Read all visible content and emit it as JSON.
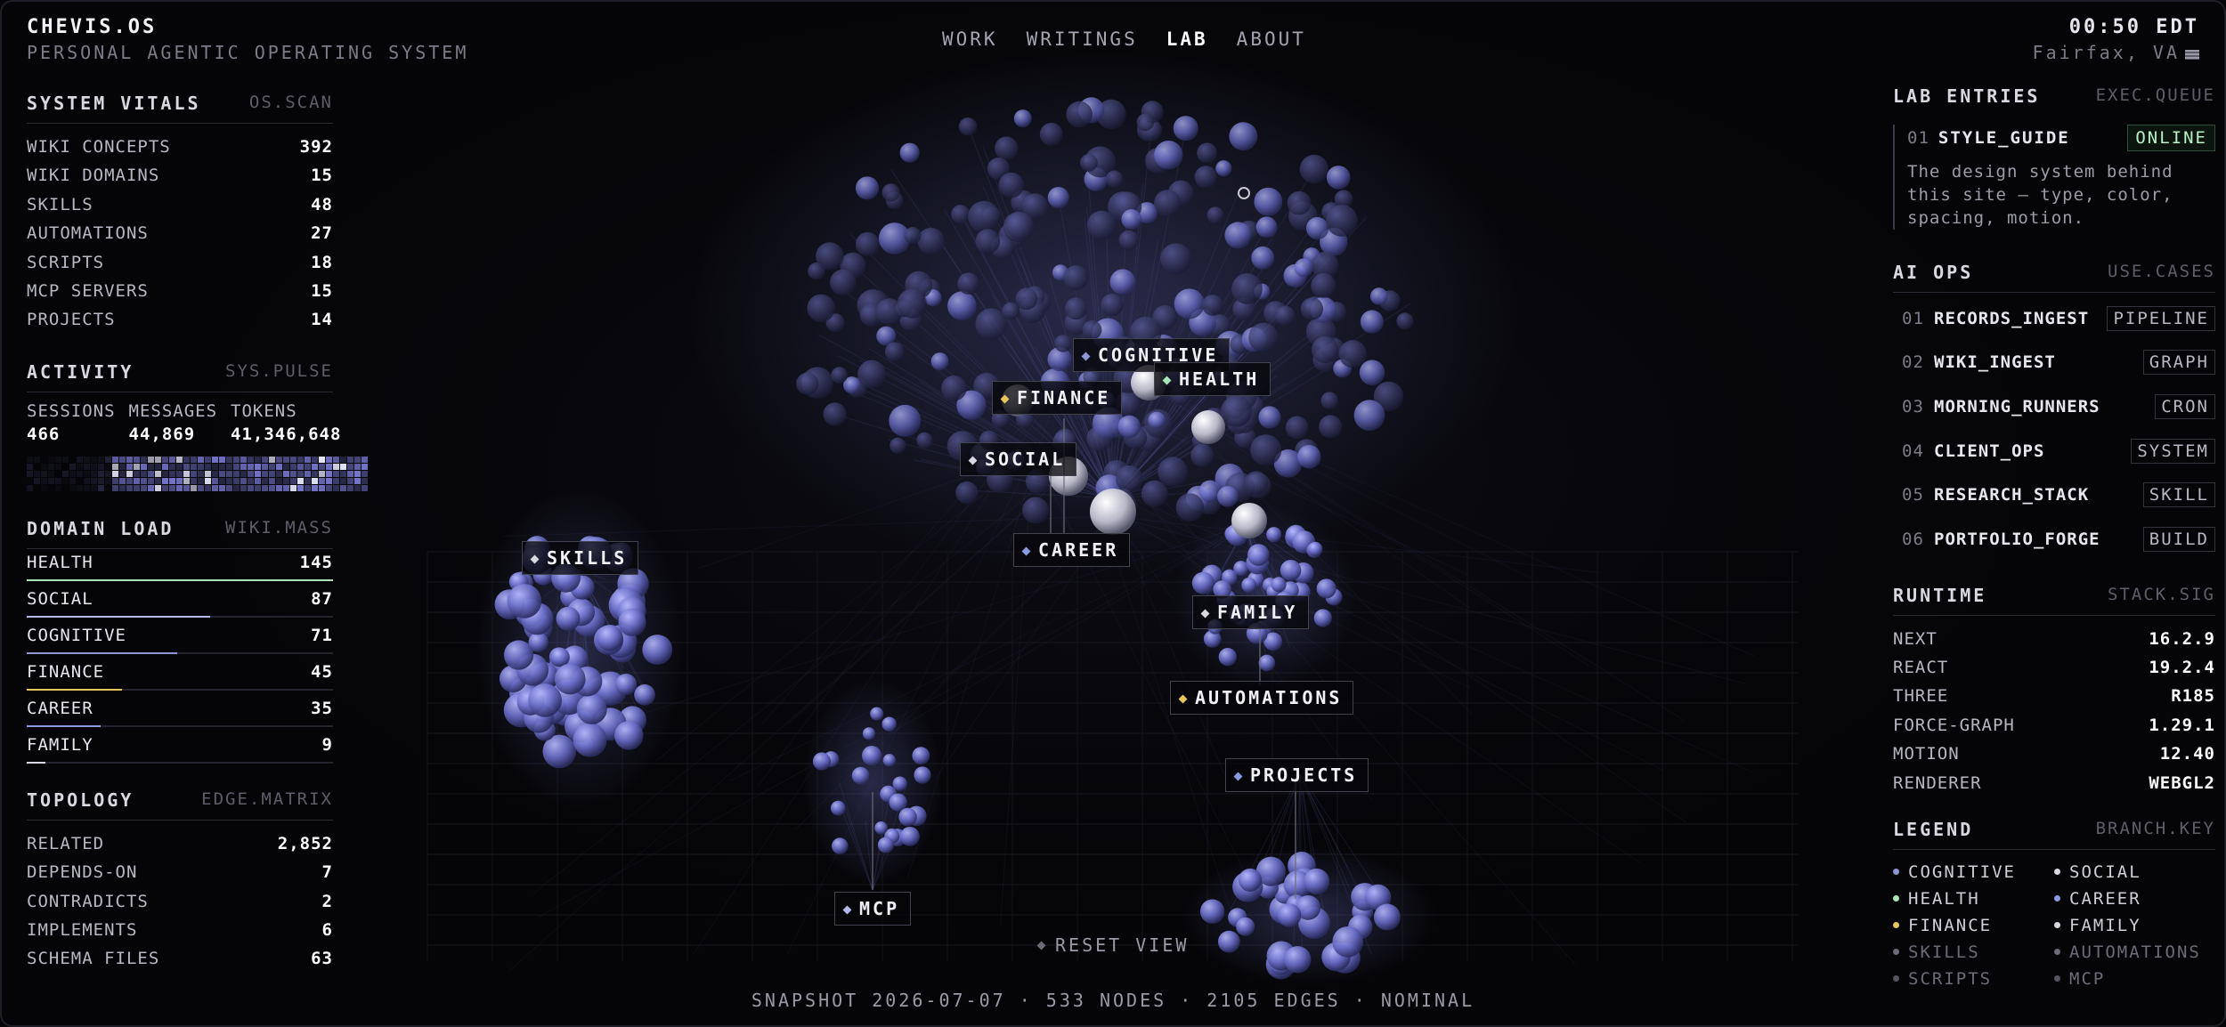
{
  "brand": {
    "title": "CHEVIS.OS",
    "subtitle": "PERSONAL AGENTIC OPERATING SYSTEM"
  },
  "nav": {
    "items": [
      {
        "label": "WORK"
      },
      {
        "label": "WRITINGS"
      },
      {
        "label": "LAB"
      },
      {
        "label": "ABOUT"
      }
    ],
    "active": "LAB"
  },
  "clock": {
    "time": "00:50 EDT",
    "location": "Fairfax, VA"
  },
  "vitals": {
    "title": "SYSTEM VITALS",
    "tag": "OS.SCAN",
    "rows": [
      {
        "label": "WIKI CONCEPTS",
        "value": "392"
      },
      {
        "label": "WIKI DOMAINS",
        "value": "15"
      },
      {
        "label": "SKILLS",
        "value": "48"
      },
      {
        "label": "AUTOMATIONS",
        "value": "27"
      },
      {
        "label": "SCRIPTS",
        "value": "18"
      },
      {
        "label": "MCP SERVERS",
        "value": "15"
      },
      {
        "label": "PROJECTS",
        "value": "14"
      }
    ]
  },
  "activity": {
    "title": "ACTIVITY",
    "tag": "SYS.PULSE",
    "stats": [
      {
        "label": "SESSIONS",
        "value": "466"
      },
      {
        "label": "MESSAGES",
        "value": "44,869"
      },
      {
        "label": "TOKENS",
        "value": "41,346,648"
      }
    ]
  },
  "domain_load": {
    "title": "DOMAIN LOAD",
    "tag": "WIKI.MASS",
    "rows": [
      {
        "label": "HEALTH",
        "value": "145",
        "fraction": 1.0,
        "color": "#a8e6b8"
      },
      {
        "label": "SOCIAL",
        "value": "87",
        "fraction": 0.6,
        "color": "#b5b8e8"
      },
      {
        "label": "COGNITIVE",
        "value": "71",
        "fraction": 0.49,
        "color": "#8f96d8"
      },
      {
        "label": "FINANCE",
        "value": "45",
        "fraction": 0.31,
        "color": "#e8c55a"
      },
      {
        "label": "CAREER",
        "value": "35",
        "fraction": 0.24,
        "color": "#8a9ae0"
      },
      {
        "label": "FAMILY",
        "value": "9",
        "fraction": 0.06,
        "color": "#d8d8e0"
      }
    ]
  },
  "topology": {
    "title": "TOPOLOGY",
    "tag": "EDGE.MATRIX",
    "rows": [
      {
        "label": "RELATED",
        "value": "2,852"
      },
      {
        "label": "DEPENDS-ON",
        "value": "7"
      },
      {
        "label": "CONTRADICTS",
        "value": "2"
      },
      {
        "label": "IMPLEMENTS",
        "value": "6"
      },
      {
        "label": "SCHEMA FILES",
        "value": "63"
      }
    ]
  },
  "lab_entries": {
    "title": "LAB ENTRIES",
    "tag": "EXEC.QUEUE",
    "items": [
      {
        "num": "01",
        "name": "STYLE_GUIDE",
        "status": "ONLINE",
        "desc": "The design system behind this site — type, color, spacing, motion."
      }
    ]
  },
  "ai_ops": {
    "title": "AI OPS",
    "tag": "USE.CASES",
    "items": [
      {
        "num": "01",
        "name": "RECORDS_INGEST",
        "tag": "PIPELINE"
      },
      {
        "num": "02",
        "name": "WIKI_INGEST",
        "tag": "GRAPH"
      },
      {
        "num": "03",
        "name": "MORNING_RUNNERS",
        "tag": "CRON"
      },
      {
        "num": "04",
        "name": "CLIENT_OPS",
        "tag": "SYSTEM"
      },
      {
        "num": "05",
        "name": "RESEARCH_STACK",
        "tag": "SKILL"
      },
      {
        "num": "06",
        "name": "PORTFOLIO_FORGE",
        "tag": "BUILD"
      }
    ]
  },
  "runtime": {
    "title": "RUNTIME",
    "tag": "STACK.SIG",
    "rows": [
      {
        "label": "NEXT",
        "value": "16.2.9"
      },
      {
        "label": "REACT",
        "value": "19.2.4"
      },
      {
        "label": "THREE",
        "value": "R185"
      },
      {
        "label": "FORCE-GRAPH",
        "value": "1.29.1"
      },
      {
        "label": "MOTION",
        "value": "12.40"
      },
      {
        "label": "RENDERER",
        "value": "WEBGL2"
      }
    ]
  },
  "legend": {
    "title": "LEGEND",
    "tag": "BRANCH.KEY",
    "items": [
      {
        "label": "COGNITIVE",
        "color": "#8f96d8",
        "dim": false
      },
      {
        "label": "SOCIAL",
        "color": "#d8d8e0",
        "dim": false
      },
      {
        "label": "HEALTH",
        "color": "#a8e6b8",
        "dim": false
      },
      {
        "label": "CAREER",
        "color": "#8a9ae0",
        "dim": false
      },
      {
        "label": "FINANCE",
        "color": "#e8c55a",
        "dim": false
      },
      {
        "label": "FAMILY",
        "color": "#d8d8e0",
        "dim": false
      },
      {
        "label": "SKILLS",
        "color": "#6c6c78",
        "dim": true
      },
      {
        "label": "AUTOMATIONS",
        "color": "#6c6c78",
        "dim": true
      },
      {
        "label": "SCRIPTS",
        "color": "#55555f",
        "dim": true
      },
      {
        "label": "MCP",
        "color": "#55555f",
        "dim": true
      }
    ]
  },
  "graph_labels": [
    {
      "id": "cognitive",
      "label": "COGNITIVE",
      "color": "#8f96d8"
    },
    {
      "id": "health",
      "label": "HEALTH",
      "color": "#a8e6b8"
    },
    {
      "id": "finance",
      "label": "FINANCE",
      "color": "#e8c55a"
    },
    {
      "id": "social",
      "label": "SOCIAL",
      "color": "#d8d8e0"
    },
    {
      "id": "career",
      "label": "CAREER",
      "color": "#8a9ae0"
    },
    {
      "id": "skills",
      "label": "SKILLS",
      "color": "#d8d8e0"
    },
    {
      "id": "family",
      "label": "FAMILY",
      "color": "#d8d8e0"
    },
    {
      "id": "automations",
      "label": "AUTOMATIONS",
      "color": "#e8c55a"
    },
    {
      "id": "projects",
      "label": "PROJECTS",
      "color": "#8a9ae0"
    },
    {
      "id": "mcp",
      "label": "MCP",
      "color": "#b5b8e8"
    }
  ],
  "reset_label": "RESET VIEW",
  "status_line": "SNAPSHOT 2026-07-07 · 533 NODES · 2105 EDGES · NOMINAL"
}
